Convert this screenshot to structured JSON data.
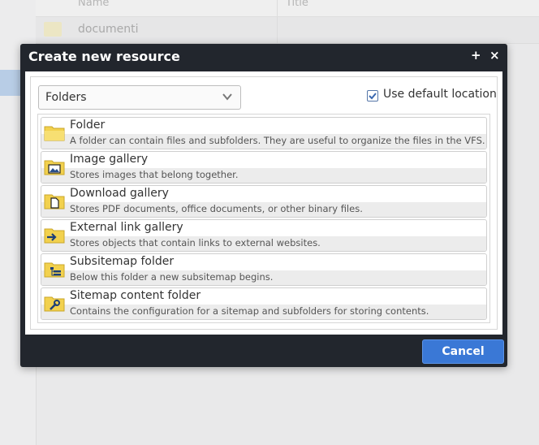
{
  "background": {
    "columns": [
      "Name",
      "Title"
    ],
    "rows": [
      {
        "name": "documenti"
      }
    ]
  },
  "dialog": {
    "title": "Create new resource",
    "maximize_glyph": "+",
    "close_glyph": "×",
    "type_select": {
      "value": "Folders"
    },
    "use_default_location": {
      "label": "Use default location",
      "checked": true
    },
    "resources": [
      {
        "name": "Folder",
        "description": "A folder can contain files and subfolders. They are useful to organize the files in the VFS. Fold",
        "icon": "folder-icon"
      },
      {
        "name": "Image gallery",
        "description": "Stores images that belong together.",
        "icon": "image-gallery-icon"
      },
      {
        "name": "Download gallery",
        "description": "Stores PDF documents, office documents, or other binary files.",
        "icon": "download-gallery-icon"
      },
      {
        "name": "External link gallery",
        "description": "Stores objects that contain links to external websites.",
        "icon": "external-link-gallery-icon"
      },
      {
        "name": "Subsitemap folder",
        "description": "Below this folder a new subsitemap begins.",
        "icon": "subsitemap-folder-icon"
      },
      {
        "name": "Sitemap content folder",
        "description": "Contains the configuration for a sitemap and subfolders for storing contents.",
        "icon": "sitemap-content-folder-icon"
      }
    ],
    "cancel_label": "Cancel"
  },
  "colors": {
    "accent": "#3a78d6",
    "titlebar": "#22262d",
    "folder": "#f2d14e"
  }
}
